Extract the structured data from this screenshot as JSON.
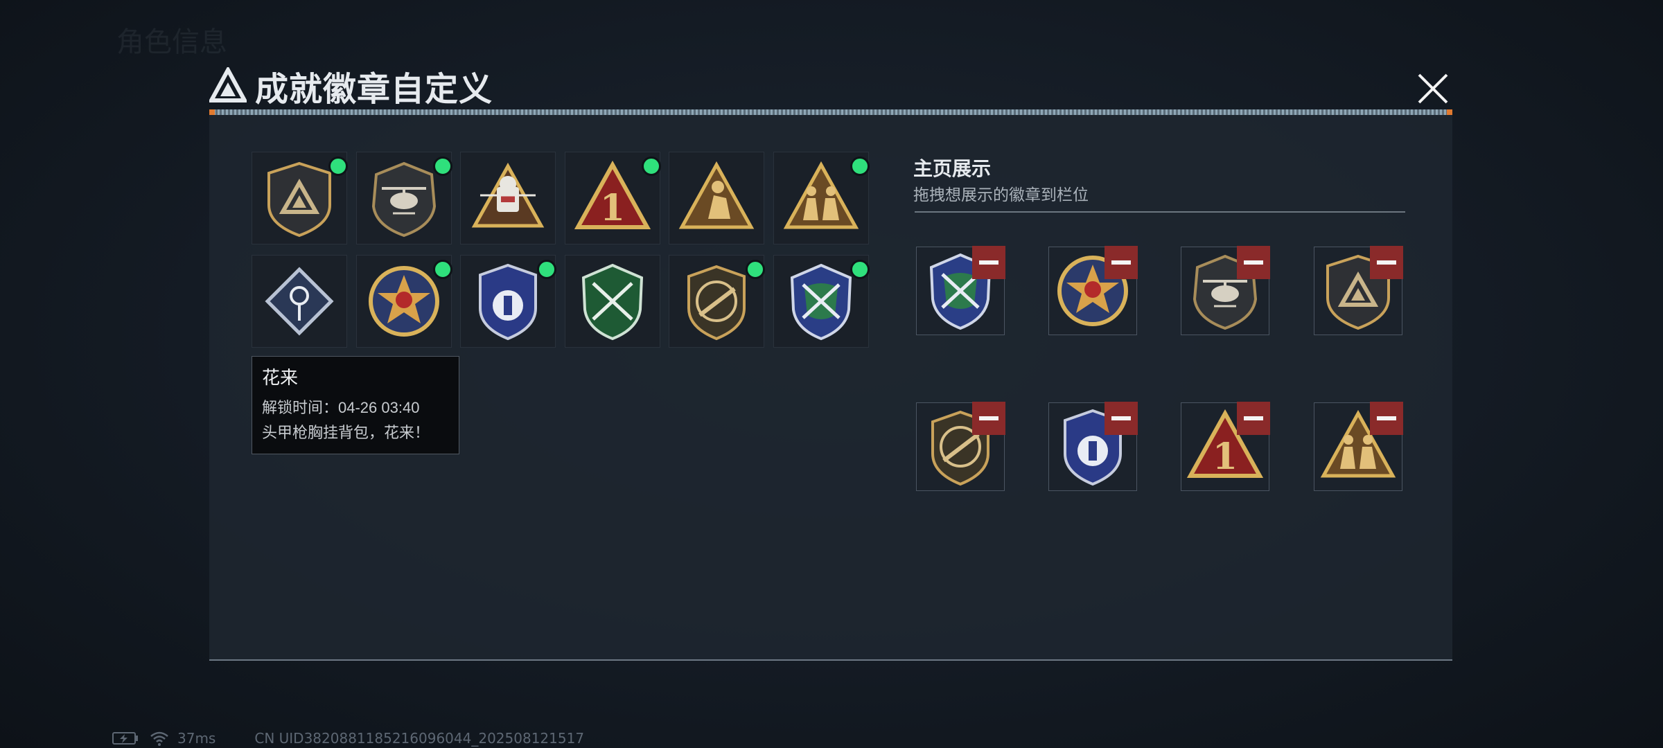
{
  "background": {
    "header_ghost": "角色信息"
  },
  "modal": {
    "title": "成就徽章自定义",
    "close_icon": "close-icon"
  },
  "badges": [
    {
      "icon": "triangle-shield-badge",
      "new": true
    },
    {
      "icon": "helicopter-shield-badge",
      "new": true
    },
    {
      "icon": "soldier-helmet-triangle-badge",
      "new": false
    },
    {
      "icon": "number-one-triangle-badge",
      "new": true
    },
    {
      "icon": "crouching-soldier-triangle-badge",
      "new": false
    },
    {
      "icon": "squad-soldiers-triangle-badge",
      "new": true
    },
    {
      "icon": "rose-diamond-badge",
      "new": false
    },
    {
      "icon": "star-skull-medal-badge",
      "new": true
    },
    {
      "icon": "police-shield-badge",
      "new": true
    },
    {
      "icon": "green-crossed-rifles-badge",
      "new": false
    },
    {
      "icon": "rifle-shield-badge",
      "new": true
    },
    {
      "icon": "blue-crossed-rifles-badge",
      "new": true
    }
  ],
  "tooltip": {
    "name": "花来",
    "unlock_time": "解锁时间：04-26 03:40",
    "description": "头甲枪胸挂背包，花来！"
  },
  "showcase": {
    "title": "主页展示",
    "subtitle": "拖拽想展示的徽章到栏位",
    "slots": [
      {
        "icon": "blue-crossed-rifles-badge"
      },
      {
        "icon": "star-skull-medal-badge"
      },
      {
        "icon": "helicopter-shield-badge"
      },
      {
        "icon": "triangle-shield-badge"
      },
      {
        "icon": "rifle-shield-badge"
      },
      {
        "icon": "police-shield-badge"
      },
      {
        "icon": "number-one-triangle-badge"
      },
      {
        "icon": "squad-soldiers-triangle-badge"
      }
    ]
  },
  "status_bar": {
    "ping": "37ms",
    "uid": "CN UID3820881185216096044_202508121517"
  },
  "colors": {
    "new_dot": "#2fe07c",
    "remove": "#8a2a2a",
    "gold": "#c9a25a",
    "panel": "#1e2630"
  }
}
